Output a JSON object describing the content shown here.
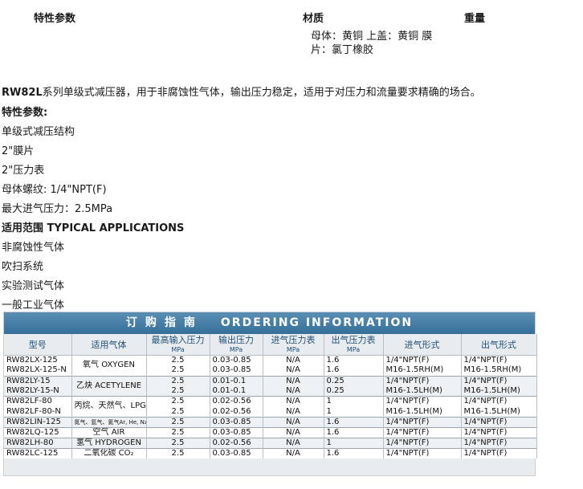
{
  "top_headers": {
    "params": "特性参数",
    "material": "材质",
    "weight": "重量"
  },
  "material_value": "母体：黄铜 上盖：黄铜 膜片：氯丁橡胶",
  "intro": {
    "model": "RW82L",
    "text": "系列单级式减压器，用于非腐蚀性气体，输出压力稳定，适用于对压力和流量要求精确的场合。"
  },
  "features": {
    "heading": "特性参数:",
    "items": [
      "单级式减压结构",
      "2\"膜片",
      "2\"压力表",
      "母体螺纹: 1/4\"NPT(F)",
      "最大进气压力：2.5MPa"
    ]
  },
  "applications": {
    "heading": "适用范围 TYPICAL APPLICATIONS",
    "items": [
      "非腐蚀性气体",
      "吹扫系统",
      "实验测试气体",
      "一般工业气体"
    ]
  },
  "ordering": {
    "title_zh": "订购指南",
    "title_en": "ORDERING INFORMATION",
    "columns": [
      {
        "label": "型号",
        "unit": ""
      },
      {
        "label": "适用气体",
        "unit": ""
      },
      {
        "label": "最高输入压力",
        "unit": "MPa"
      },
      {
        "label": "输出压力",
        "unit": "MPa"
      },
      {
        "label": "进气压力表",
        "unit": "MPa"
      },
      {
        "label": "出气压力表",
        "unit": "MPa"
      },
      {
        "label": "进气形式",
        "unit": ""
      },
      {
        "label": "出气形式",
        "unit": ""
      }
    ],
    "groups": [
      {
        "app": "氧气 OXYGEN",
        "small": false,
        "rows": [
          [
            "RW82LX-125",
            "2.5",
            "0.03-0.85",
            "N/A",
            "1.6",
            "1/4\"NPT(F)",
            "1/4\"NPT(F)"
          ],
          [
            "RW82LX-125-N",
            "2.5",
            "0.03-0.85",
            "N/A",
            "1.6",
            "M16-1.5RH(M)",
            "M16-1.5RH(M)"
          ]
        ]
      },
      {
        "app": "乙炔 ACETYLENE",
        "small": false,
        "rows": [
          [
            "RW82LY-15",
            "2.5",
            "0.01-0.1",
            "N/A",
            "0.25",
            "1/4\"NPT(F)",
            "1/4\"NPT(F)"
          ],
          [
            "RW82LY-15-N",
            "2.5",
            "0.01-0.1",
            "N/A",
            "0.25",
            "M16-1.5LH(M)",
            "M16-1.5LH(M)"
          ]
        ]
      },
      {
        "app": "丙烷、天然气、LPG",
        "small": false,
        "rows": [
          [
            "RW82LF-80",
            "2.5",
            "0.02-0.56",
            "N/A",
            "1",
            "1/4\"NPT(F)",
            "1/4\"NPT(F)"
          ],
          [
            "RW82LF-80-N",
            "2.5",
            "0.02-0.56",
            "N/A",
            "1",
            "M16-1.5LH(M)",
            "M16-1.5LH(M)"
          ]
        ]
      },
      {
        "app": "氮气、氩气、氦气Ar, He, N₂",
        "small": true,
        "rows": [
          [
            "RW82LIN-125",
            "2.5",
            "0.03-0.85",
            "N/A",
            "1.6",
            "1/4\"NPT(F)",
            "1/4\"NPT(F)"
          ]
        ]
      },
      {
        "app": "空气 AIR",
        "small": false,
        "rows": [
          [
            "RW82LQ-125",
            "2.5",
            "0.03-0.85",
            "N/A",
            "1.6",
            "1/4\"NPT(F)",
            "1/4\"NPT(F)"
          ]
        ]
      },
      {
        "app": "氢气 HYDROGEN",
        "small": false,
        "rows": [
          [
            "RW82LH-80",
            "2.5",
            "0.02-0.56",
            "N/A",
            "1",
            "1/4\"NPT(F)",
            "1/4\"NPT(F)"
          ]
        ]
      },
      {
        "app": "二氧化碳 CO₂",
        "small": false,
        "rows": [
          [
            "RW82LC-125",
            "2.5",
            "0.03-0.85",
            "N/A",
            "1.6",
            "1/4\"NPT(F)",
            "1/4\"NPT(F)"
          ]
        ]
      }
    ]
  }
}
